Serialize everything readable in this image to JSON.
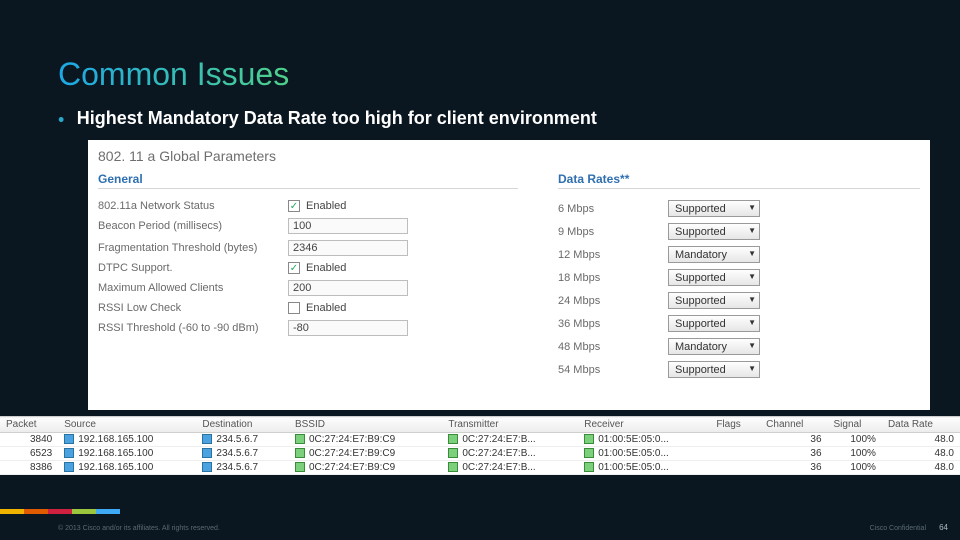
{
  "title": "Common Issues",
  "bullet": "Highest Mandatory Data Rate too high for client environment",
  "panel": {
    "heading": "802. 11 a Global Parameters",
    "general_label": "General",
    "datarates_label": "Data Rates**",
    "general": [
      {
        "label": "802.11a Network Status",
        "type": "checkbox",
        "checked": true,
        "text": "Enabled"
      },
      {
        "label": "Beacon Period (millisecs)",
        "type": "input",
        "value": "100"
      },
      {
        "label": "Fragmentation Threshold (bytes)",
        "type": "input",
        "value": "2346"
      },
      {
        "label": "DTPC Support.",
        "type": "checkbox",
        "checked": true,
        "text": "Enabled"
      },
      {
        "label": "Maximum Allowed Clients",
        "type": "input",
        "value": "200"
      },
      {
        "label": "RSSI Low Check",
        "type": "checkbox",
        "checked": false,
        "text": "Enabled"
      },
      {
        "label": "RSSI Threshold (-60 to -90 dBm)",
        "type": "input",
        "value": "-80"
      }
    ],
    "rates": [
      {
        "label": "6 Mbps",
        "value": "Supported"
      },
      {
        "label": "9 Mbps",
        "value": "Supported"
      },
      {
        "label": "12 Mbps",
        "value": "Mandatory"
      },
      {
        "label": "18 Mbps",
        "value": "Supported"
      },
      {
        "label": "24 Mbps",
        "value": "Supported"
      },
      {
        "label": "36 Mbps",
        "value": "Supported"
      },
      {
        "label": "48 Mbps",
        "value": "Mandatory"
      },
      {
        "label": "54 Mbps",
        "value": "Supported"
      }
    ]
  },
  "capture": {
    "headers": [
      "Packet",
      "Source",
      "Destination",
      "BSSID",
      "Transmitter",
      "Receiver",
      "Flags",
      "Channel",
      "Signal",
      "Data Rate"
    ],
    "rows": [
      {
        "packet": "3840",
        "source": "192.168.165.100",
        "dest": "234.5.6.7",
        "bssid": "0C:27:24:E7:B9:C9",
        "tx": "0C:27:24:E7:B...",
        "rx": "01:00:5E:05:0...",
        "flags": "",
        "channel": "36",
        "signal": "100%",
        "rate": "48.0"
      },
      {
        "packet": "6523",
        "source": "192.168.165.100",
        "dest": "234.5.6.7",
        "bssid": "0C:27:24:E7:B9:C9",
        "tx": "0C:27:24:E7:B...",
        "rx": "01:00:5E:05:0...",
        "flags": "",
        "channel": "36",
        "signal": "100%",
        "rate": "48.0"
      },
      {
        "packet": "8386",
        "source": "192.168.165.100",
        "dest": "234.5.6.7",
        "bssid": "0C:27:24:E7:B9:C9",
        "tx": "0C:27:24:E7:B...",
        "rx": "01:00:5E:05:0...",
        "flags": "",
        "channel": "36",
        "signal": "100%",
        "rate": "48.0"
      }
    ]
  },
  "footer": {
    "left": "© 2013 Cisco and/or its affiliates. All rights reserved.",
    "right": "Cisco Confidential",
    "page": "64"
  }
}
